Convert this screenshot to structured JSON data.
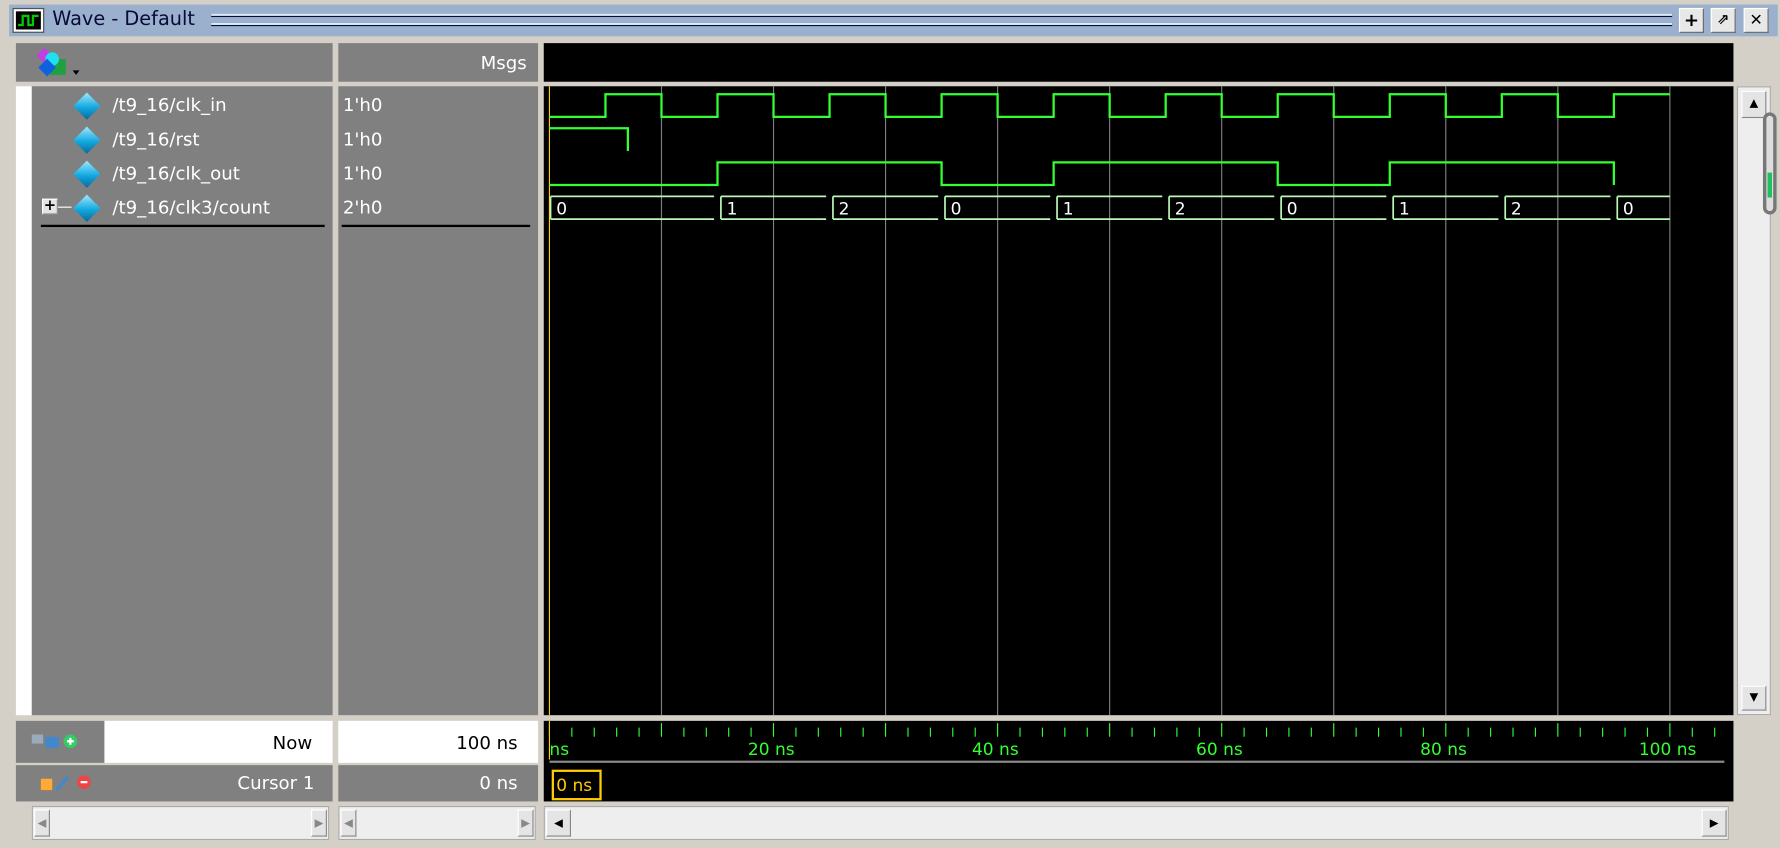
{
  "window": {
    "title": "Wave - Default",
    "buttons": [
      {
        "name": "dock",
        "glyph": "+"
      },
      {
        "name": "undock",
        "glyph": "⇗"
      },
      {
        "name": "close",
        "glyph": "✕"
      }
    ]
  },
  "header": {
    "msgs_label": "Msgs"
  },
  "signals": [
    {
      "name": "/t9_16/clk_in",
      "value": "1'h0",
      "type": "bit"
    },
    {
      "name": "/t9_16/rst",
      "value": "1'h0",
      "type": "bit"
    },
    {
      "name": "/t9_16/clk_out",
      "value": "1'h0",
      "type": "bit"
    },
    {
      "name": "/t9_16/clk3/count",
      "value": "2'h0",
      "type": "bus",
      "expandable": true
    }
  ],
  "waveforms": {
    "time_unit": "ns",
    "range": [
      0,
      100
    ],
    "clk_in": {
      "initial": 0,
      "edges": [
        5,
        10,
        15,
        20,
        25,
        30,
        35,
        40,
        45,
        50,
        55,
        60,
        65,
        70,
        75,
        80,
        85,
        90,
        95,
        100
      ]
    },
    "rst": {
      "initial": 1,
      "edges": [
        7
      ]
    },
    "clk_out": {
      "initial": 0,
      "edges": [
        15,
        35,
        45,
        65,
        75,
        95
      ]
    },
    "count": [
      {
        "t": 0,
        "v": "0"
      },
      {
        "t": 15,
        "v": "1"
      },
      {
        "t": 25,
        "v": "2"
      },
      {
        "t": 35,
        "v": "0"
      },
      {
        "t": 45,
        "v": "1"
      },
      {
        "t": 55,
        "v": "2"
      },
      {
        "t": 65,
        "v": "0"
      },
      {
        "t": 75,
        "v": "1"
      },
      {
        "t": 85,
        "v": "2"
      },
      {
        "t": 95,
        "v": "0"
      }
    ],
    "wave_color": "#33ff33",
    "bus_color": "#b8f8b8",
    "grid_color": "#808080"
  },
  "timeline": {
    "labels": [
      "ns",
      "20 ns",
      "40 ns",
      "60 ns",
      "80 ns",
      "100 ns"
    ],
    "label_times": [
      0,
      20,
      40,
      60,
      80,
      100
    ]
  },
  "now": {
    "label": "Now",
    "value": "100 ns"
  },
  "cursor": {
    "label": "Cursor 1",
    "value": "0 ns",
    "marker": "0 ns",
    "color": "#ffcc00"
  }
}
